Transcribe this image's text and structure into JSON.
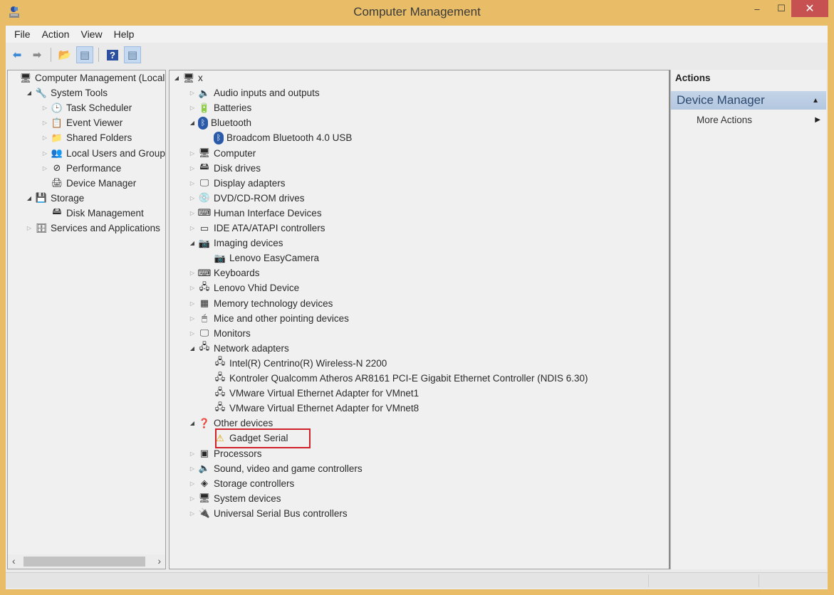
{
  "window": {
    "title": "Computer Management",
    "controls": {
      "minimize": "–",
      "maximize": "☐",
      "close": "✕"
    }
  },
  "menubar": [
    "File",
    "Action",
    "View",
    "Help"
  ],
  "toolbar": [
    {
      "name": "back-button",
      "icon": "back-arrow-icon",
      "glyph": "⬅",
      "color": "#3a8ad6",
      "active": false
    },
    {
      "name": "forward-button",
      "icon": "forward-arrow-icon",
      "glyph": "➡",
      "color": "#8a8a8a",
      "active": false
    },
    {
      "sep": true
    },
    {
      "name": "up-level-button",
      "icon": "folder-up-icon",
      "glyph": "📂",
      "color": "#c8a030",
      "active": false
    },
    {
      "name": "show-hide-console-tree-button",
      "icon": "console-tree-icon",
      "glyph": "▤",
      "color": "#5a7a9a",
      "active": true
    },
    {
      "sep": true
    },
    {
      "name": "help-button",
      "icon": "help-icon",
      "glyph": "?",
      "color": "#2c4fa0",
      "active": false
    },
    {
      "name": "show-hide-action-pane-button",
      "icon": "action-pane-icon",
      "glyph": "▤",
      "color": "#5a7a9a",
      "active": true
    }
  ],
  "left_tree": [
    {
      "label": "Computer Management (Local",
      "level": 0,
      "exp": "",
      "icon": "computer-management-icon",
      "glyph": "🖥"
    },
    {
      "label": "System Tools",
      "level": 1,
      "exp": "open",
      "icon": "tools-icon",
      "glyph": "🔧"
    },
    {
      "label": "Task Scheduler",
      "level": 2,
      "exp": "closed",
      "icon": "clock-icon",
      "glyph": "🕒"
    },
    {
      "label": "Event Viewer",
      "level": 2,
      "exp": "closed",
      "icon": "event-viewer-icon",
      "glyph": "📋"
    },
    {
      "label": "Shared Folders",
      "level": 2,
      "exp": "closed",
      "icon": "shared-folder-icon",
      "glyph": "📁"
    },
    {
      "label": "Local Users and Groups",
      "level": 2,
      "exp": "closed",
      "icon": "users-icon",
      "glyph": "👥"
    },
    {
      "label": "Performance",
      "level": 2,
      "exp": "closed",
      "icon": "performance-icon",
      "glyph": "⊘"
    },
    {
      "label": "Device Manager",
      "level": 2,
      "exp": "",
      "icon": "device-manager-icon",
      "glyph": "🖨"
    },
    {
      "label": "Storage",
      "level": 1,
      "exp": "open",
      "icon": "storage-icon",
      "glyph": "💾"
    },
    {
      "label": "Disk Management",
      "level": 2,
      "exp": "",
      "icon": "disk-management-icon",
      "glyph": "🖴"
    },
    {
      "label": "Services and Applications",
      "level": 1,
      "exp": "closed",
      "icon": "services-icon",
      "glyph": "🗄"
    }
  ],
  "device_tree": [
    {
      "label": "x",
      "level": 0,
      "exp": "open",
      "icon": "computer-root-icon",
      "glyph": "🖥"
    },
    {
      "label": "Audio inputs and outputs",
      "level": 1,
      "exp": "closed",
      "icon": "speaker-icon",
      "glyph": "🔈"
    },
    {
      "label": "Batteries",
      "level": 1,
      "exp": "closed",
      "icon": "battery-icon",
      "glyph": "🔋"
    },
    {
      "label": "Bluetooth",
      "level": 1,
      "exp": "open",
      "icon": "bluetooth-icon",
      "glyph": "ᛒ"
    },
    {
      "label": "Broadcom Bluetooth 4.0 USB",
      "level": 2,
      "exp": "",
      "icon": "bluetooth-device-icon",
      "glyph": "ᛒ"
    },
    {
      "label": "Computer",
      "level": 1,
      "exp": "closed",
      "icon": "computer-icon",
      "glyph": "🖥"
    },
    {
      "label": "Disk drives",
      "level": 1,
      "exp": "closed",
      "icon": "disk-drive-icon",
      "glyph": "🖴"
    },
    {
      "label": "Display adapters",
      "level": 1,
      "exp": "closed",
      "icon": "display-adapter-icon",
      "glyph": "🖵"
    },
    {
      "label": "DVD/CD-ROM drives",
      "level": 1,
      "exp": "closed",
      "icon": "dvd-drive-icon",
      "glyph": "💿"
    },
    {
      "label": "Human Interface Devices",
      "level": 1,
      "exp": "closed",
      "icon": "hid-icon",
      "glyph": "⌨"
    },
    {
      "label": "IDE ATA/ATAPI controllers",
      "level": 1,
      "exp": "closed",
      "icon": "ide-controller-icon",
      "glyph": "▭"
    },
    {
      "label": "Imaging devices",
      "level": 1,
      "exp": "open",
      "icon": "camera-icon",
      "glyph": "📷"
    },
    {
      "label": "Lenovo EasyCamera",
      "level": 2,
      "exp": "",
      "icon": "webcam-icon",
      "glyph": "📷"
    },
    {
      "label": "Keyboards",
      "level": 1,
      "exp": "closed",
      "icon": "keyboard-icon",
      "glyph": "⌨"
    },
    {
      "label": "Lenovo Vhid Device",
      "level": 1,
      "exp": "closed",
      "icon": "network-device-icon",
      "glyph": "🖧"
    },
    {
      "label": "Memory technology devices",
      "level": 1,
      "exp": "closed",
      "icon": "memory-icon",
      "glyph": "▦"
    },
    {
      "label": "Mice and other pointing devices",
      "level": 1,
      "exp": "closed",
      "icon": "mouse-icon",
      "glyph": "🖱"
    },
    {
      "label": "Monitors",
      "level": 1,
      "exp": "closed",
      "icon": "monitor-icon",
      "glyph": "🖵"
    },
    {
      "label": "Network adapters",
      "level": 1,
      "exp": "open",
      "icon": "network-adapter-icon",
      "glyph": "🖧"
    },
    {
      "label": "Intel(R) Centrino(R) Wireless-N 2200",
      "level": 2,
      "exp": "",
      "icon": "network-adapter-icon",
      "glyph": "🖧"
    },
    {
      "label": "Kontroler Qualcomm Atheros AR8161 PCI-E Gigabit Ethernet Controller (NDIS 6.30)",
      "level": 2,
      "exp": "",
      "icon": "network-adapter-icon",
      "glyph": "🖧"
    },
    {
      "label": "VMware Virtual Ethernet Adapter for VMnet1",
      "level": 2,
      "exp": "",
      "icon": "network-adapter-icon",
      "glyph": "🖧"
    },
    {
      "label": "VMware Virtual Ethernet Adapter for VMnet8",
      "level": 2,
      "exp": "",
      "icon": "network-adapter-icon",
      "glyph": "🖧"
    },
    {
      "label": "Other devices",
      "level": 1,
      "exp": "open",
      "icon": "unknown-device-icon",
      "glyph": "❓"
    },
    {
      "label": "Gadget Serial",
      "level": 2,
      "exp": "",
      "icon": "warning-device-icon",
      "glyph": "⚠"
    },
    {
      "label": "Processors",
      "level": 1,
      "exp": "closed",
      "icon": "processor-icon",
      "glyph": "▣"
    },
    {
      "label": "Sound, video and game controllers",
      "level": 1,
      "exp": "closed",
      "icon": "speaker-icon",
      "glyph": "🔈"
    },
    {
      "label": "Storage controllers",
      "level": 1,
      "exp": "closed",
      "icon": "storage-controller-icon",
      "glyph": "◈"
    },
    {
      "label": "System devices",
      "level": 1,
      "exp": "closed",
      "icon": "system-device-icon",
      "glyph": "🖥"
    },
    {
      "label": "Universal Serial Bus controllers",
      "level": 1,
      "exp": "closed",
      "icon": "usb-icon",
      "glyph": "🔌"
    }
  ],
  "highlighted_item": "Gadget Serial",
  "highlight_color": "#d0202a",
  "actions": {
    "header": "Actions",
    "section": "Device Manager",
    "section_caret": "▲",
    "more": "More Actions",
    "more_caret": "▶"
  },
  "scroll": {
    "left": "‹",
    "right": "›"
  }
}
